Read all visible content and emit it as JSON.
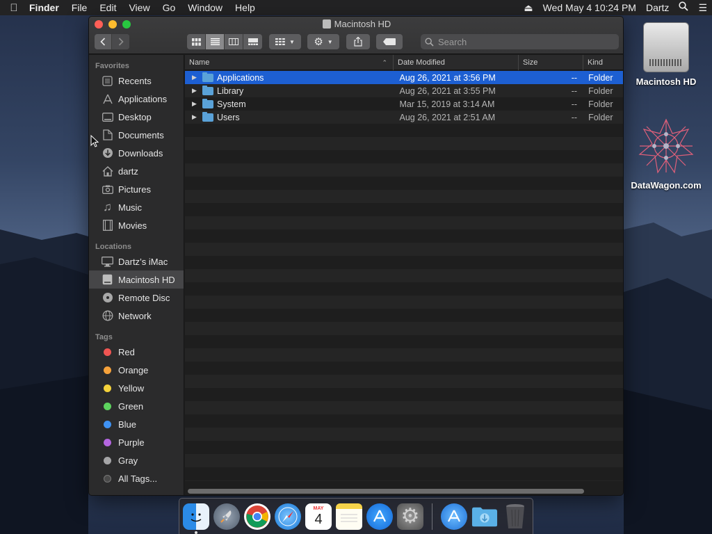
{
  "menubar": {
    "app_name": "Finder",
    "menus": [
      "File",
      "Edit",
      "View",
      "Go",
      "Window",
      "Help"
    ],
    "clock": "Wed May 4  10:24 PM",
    "user": "Dartz"
  },
  "window": {
    "title": "Macintosh HD",
    "search_placeholder": "Search"
  },
  "sidebar": {
    "favorites_heading": "Favorites",
    "favorites": [
      {
        "label": "Recents",
        "icon": "recents-icon"
      },
      {
        "label": "Applications",
        "icon": "applications-icon"
      },
      {
        "label": "Desktop",
        "icon": "desktop-icon"
      },
      {
        "label": "Documents",
        "icon": "documents-icon"
      },
      {
        "label": "Downloads",
        "icon": "downloads-icon"
      },
      {
        "label": "dartz",
        "icon": "home-icon"
      },
      {
        "label": "Pictures",
        "icon": "pictures-icon"
      },
      {
        "label": "Music",
        "icon": "music-icon"
      },
      {
        "label": "Movies",
        "icon": "movies-icon"
      }
    ],
    "locations_heading": "Locations",
    "locations": [
      {
        "label": "Dartz’s iMac",
        "icon": "imac-icon"
      },
      {
        "label": "Macintosh HD",
        "icon": "hard-drive-icon",
        "selected": true
      },
      {
        "label": "Remote Disc",
        "icon": "disc-icon"
      },
      {
        "label": "Network",
        "icon": "network-icon"
      }
    ],
    "tags_heading": "Tags",
    "tags": [
      {
        "label": "Red",
        "color": "#f05552"
      },
      {
        "label": "Orange",
        "color": "#f6a23b"
      },
      {
        "label": "Yellow",
        "color": "#f4d23b"
      },
      {
        "label": "Green",
        "color": "#5dd35e"
      },
      {
        "label": "Blue",
        "color": "#3f92f3"
      },
      {
        "label": "Purple",
        "color": "#b466e0"
      },
      {
        "label": "Gray",
        "color": "#a5a5a7"
      },
      {
        "label": "All Tags...",
        "color": "#4a4a4a"
      }
    ]
  },
  "list": {
    "columns": [
      "Name",
      "Date Modified",
      "Size",
      "Kind"
    ],
    "rows": [
      {
        "name": "Applications",
        "date": "Aug 26, 2021 at 3:56 PM",
        "size": "--",
        "kind": "Folder",
        "selected": true
      },
      {
        "name": "Library",
        "date": "Aug 26, 2021 at 3:55 PM",
        "size": "--",
        "kind": "Folder"
      },
      {
        "name": "System",
        "date": "Mar 15, 2019 at 3:14 AM",
        "size": "--",
        "kind": "Folder"
      },
      {
        "name": "Users",
        "date": "Aug 26, 2021 at 2:51 AM",
        "size": "--",
        "kind": "Folder"
      }
    ]
  },
  "desktop": {
    "icons": [
      "Macintosh HD",
      "DataWagon.com"
    ]
  },
  "dock": {
    "apps": [
      "finder-icon",
      "launchpad-icon",
      "chrome-icon",
      "safari-icon",
      "calendar-icon",
      "notes-icon",
      "app-store-icon",
      "system-preferences-icon",
      "app-store-download-icon",
      "downloads-folder-icon",
      "trash-icon"
    ],
    "calendar_month": "MAY",
    "calendar_day": "4"
  }
}
